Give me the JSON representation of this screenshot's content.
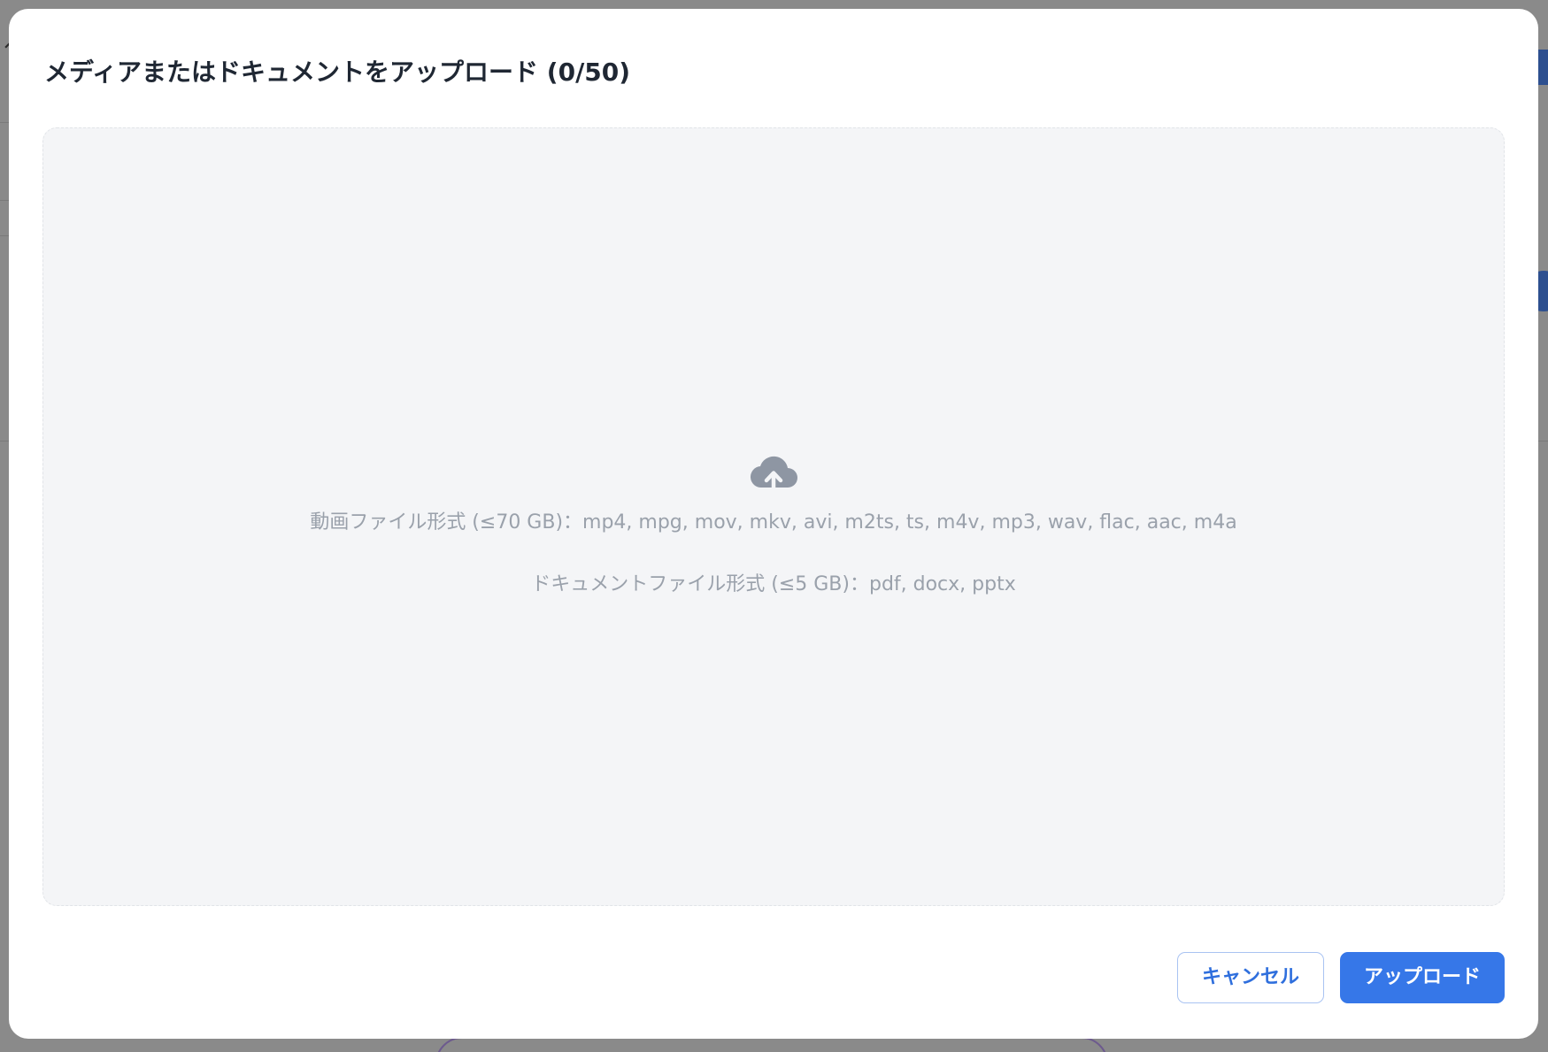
{
  "modal": {
    "title": "メディアまたはドキュメントをアップロード (0/50)",
    "dropzone": {
      "icon": "cloud-upload-icon",
      "video_formats": "動画ファイル形式 (≤70 GB)：mp4, mpg, mov, mkv, avi, m2ts, ts, m4v, mp3, wav, flac, aac, m4a",
      "document_formats": "ドキュメントファイル形式 (≤5 GB)：pdf, docx, pptx"
    },
    "buttons": {
      "cancel_label": "キャンセル",
      "upload_label": "アップロード"
    }
  },
  "colors": {
    "primary": "#3677e8",
    "overlay": "#8a8a8a",
    "dropzone_bg": "#f4f5f7",
    "muted_text": "#9aa1ab",
    "title_text": "#1f2733"
  }
}
